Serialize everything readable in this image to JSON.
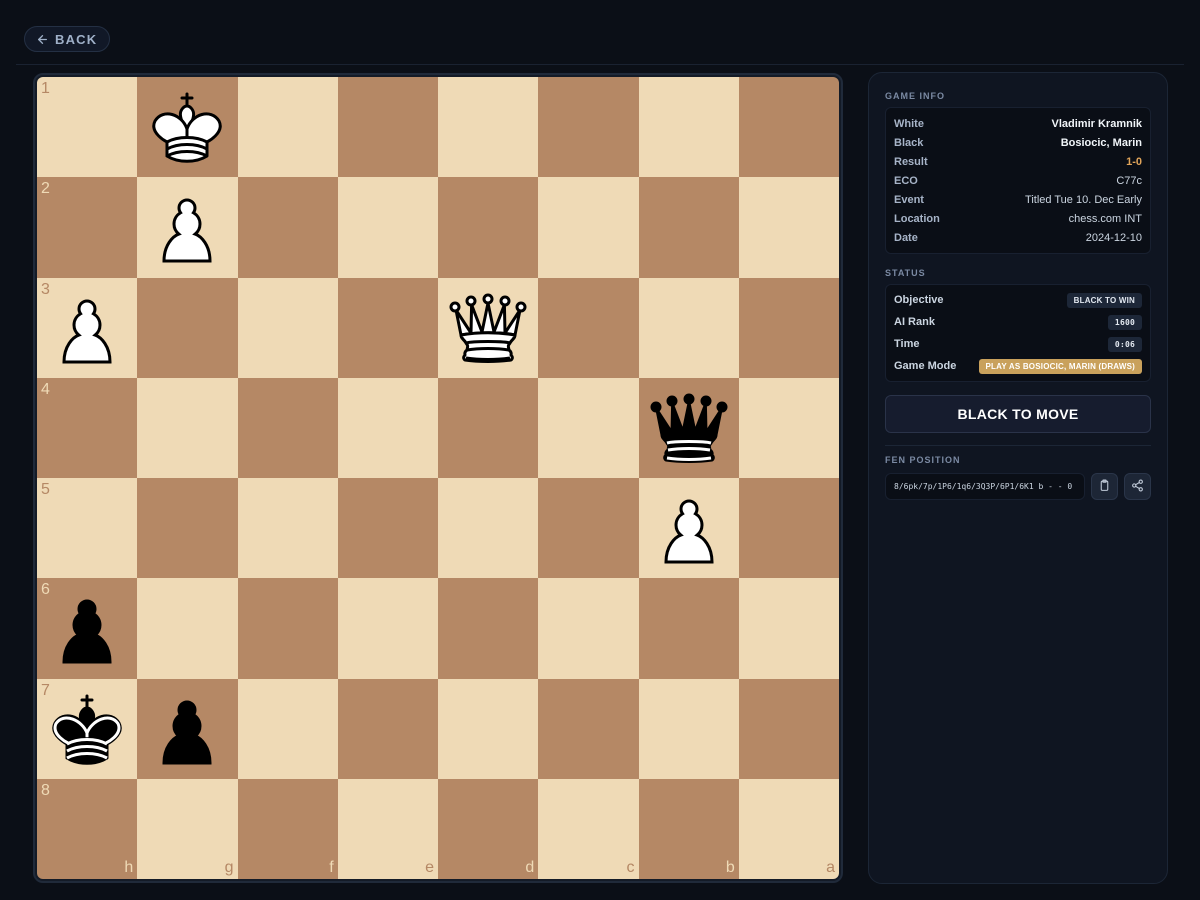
{
  "nav": {
    "back_label": "BACK"
  },
  "board": {
    "rank_labels": [
      "1",
      "2",
      "3",
      "4",
      "5",
      "6",
      "7",
      "8"
    ],
    "file_labels": [
      "h",
      "g",
      "f",
      "e",
      "d",
      "c",
      "b",
      "a"
    ],
    "pieces": [
      {
        "square": "g1",
        "type": "king",
        "color": "white"
      },
      {
        "square": "g2",
        "type": "pawn",
        "color": "white"
      },
      {
        "square": "h3",
        "type": "pawn",
        "color": "white"
      },
      {
        "square": "d3",
        "type": "queen",
        "color": "white"
      },
      {
        "square": "b4",
        "type": "queen",
        "color": "black"
      },
      {
        "square": "b5",
        "type": "pawn",
        "color": "white"
      },
      {
        "square": "h6",
        "type": "pawn",
        "color": "black"
      },
      {
        "square": "h7",
        "type": "king",
        "color": "black"
      },
      {
        "square": "g7",
        "type": "pawn",
        "color": "black"
      }
    ],
    "colors": {
      "light": "#efdab6",
      "dark": "#b58865"
    }
  },
  "game_info": {
    "title": "GAME INFO",
    "rows": [
      {
        "label": "White",
        "value": "Vladimir Kramnik",
        "style": "strong"
      },
      {
        "label": "Black",
        "value": "Bosiocic, Marin",
        "style": "strong"
      },
      {
        "label": "Result",
        "value": "1-0",
        "style": "accent"
      },
      {
        "label": "ECO",
        "value": "C77c",
        "style": ""
      },
      {
        "label": "Event",
        "value": "Titled Tue 10. Dec Early",
        "style": ""
      },
      {
        "label": "Location",
        "value": "chess.com INT",
        "style": ""
      },
      {
        "label": "Date",
        "value": "2024-12-10",
        "style": ""
      }
    ]
  },
  "status": {
    "title": "STATUS",
    "objective_label": "Objective",
    "objective_value": "BLACK TO WIN",
    "ai_rank_label": "AI Rank",
    "ai_rank_value": "1600",
    "time_label": "Time",
    "time_value": "0:06",
    "mode_label": "Game Mode",
    "mode_value": "PLAY AS BOSIOCIC, MARIN (DRAWS)"
  },
  "move_indicator": "BLACK TO MOVE",
  "fen": {
    "title": "FEN POSITION",
    "value": "8/6pk/7p/1P6/1q6/3Q3P/6P1/6K1 b - - 0"
  },
  "icons": {
    "back": "arrow-left-icon",
    "copy": "clipboard-icon",
    "share": "share-icon"
  }
}
